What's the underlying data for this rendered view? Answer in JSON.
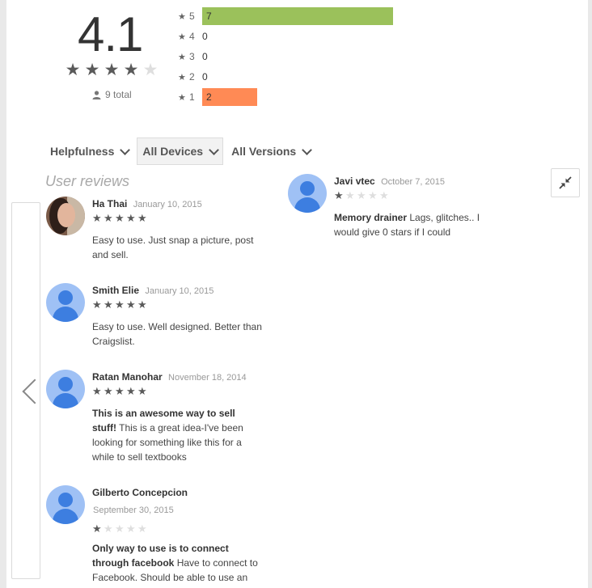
{
  "summary": {
    "score": "4.1",
    "stars_filled": 4,
    "total": "9 total",
    "histogram": [
      {
        "star": "5",
        "count": "7",
        "fraction": 0.63,
        "color": "#9bc15b"
      },
      {
        "star": "4",
        "count": "0",
        "fraction": 0,
        "color": "#9bc15b"
      },
      {
        "star": "3",
        "count": "0",
        "fraction": 0,
        "color": "#9bc15b"
      },
      {
        "star": "2",
        "count": "0",
        "fraction": 0,
        "color": "#9bc15b"
      },
      {
        "star": "1",
        "count": "2",
        "fraction": 0.18,
        "color": "#ff8a55"
      }
    ]
  },
  "filters": {
    "sort_label": "Helpfulness",
    "devices_label": "All Devices",
    "versions_label": "All Versions"
  },
  "reviews_heading": "User reviews",
  "icons": {
    "star": "star-icon",
    "person": "person-icon",
    "chevron_down": "chevron-down-icon",
    "chevron_left": "chevron-left-icon",
    "collapse": "collapse-icon"
  },
  "reviews": [
    {
      "author": "Ha Thai",
      "date": "January 10, 2015",
      "rating": 5,
      "title": "",
      "text": "Easy to use. Just snap a picture, post and sell."
    },
    {
      "author": "Smith Elie",
      "date": "January 10, 2015",
      "rating": 5,
      "title": "",
      "text": "Easy to use. Well designed. Better than Craigslist."
    },
    {
      "author": "Ratan Manohar",
      "date": "November 18, 2014",
      "rating": 5,
      "title": "This is an awesome way to sell stuff!",
      "text": "This is a great idea-I've been looking for something like this for a while to sell textbooks"
    },
    {
      "author": "Gilberto Concepcion",
      "date": "September 30, 2015",
      "rating": 1,
      "title": "Only way to use is to connect through facebook",
      "text": "Have to connect to Facebook. Should be able to use an"
    },
    {
      "author": "Javi vtec",
      "date": "October 7, 2015",
      "rating": 1,
      "title": "Memory drainer",
      "text": "Lags, glitches.. I would give 0 stars if I could"
    }
  ]
}
